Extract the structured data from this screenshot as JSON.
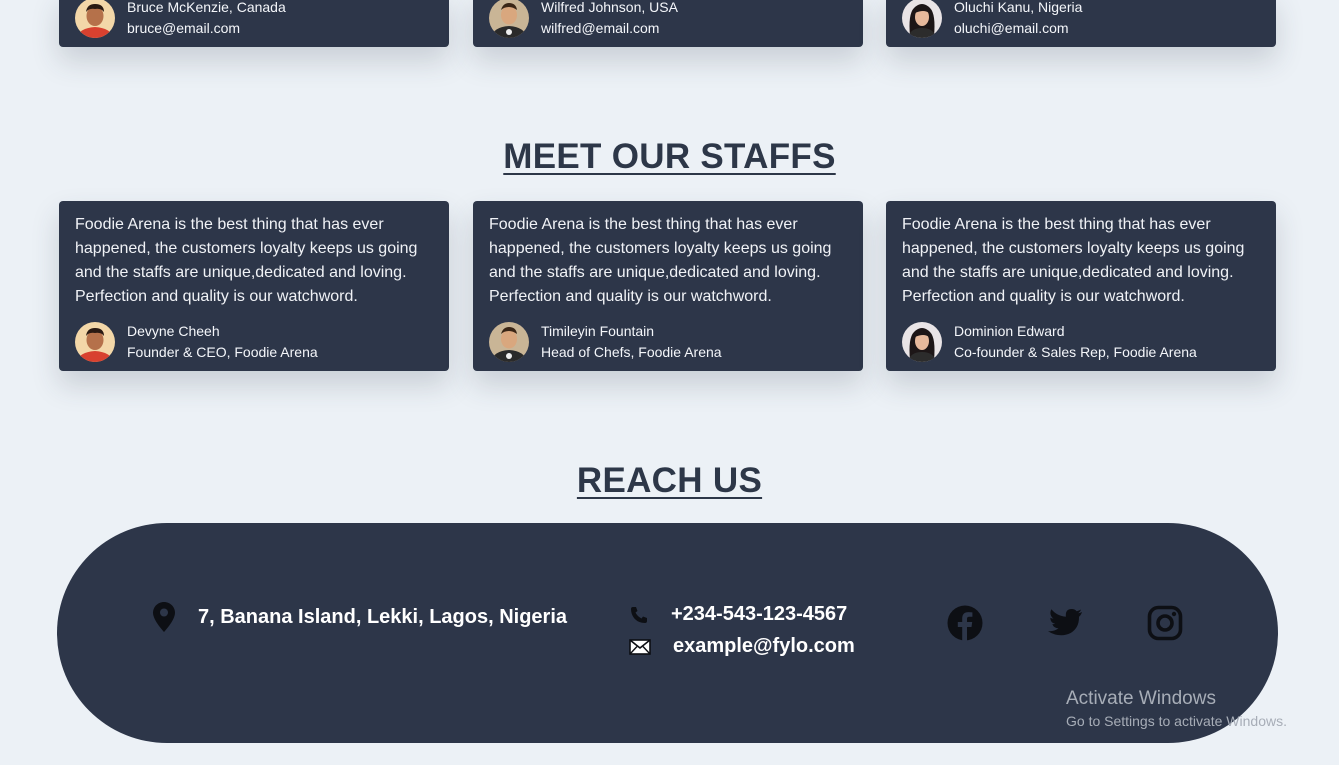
{
  "customers": [
    {
      "name": "Bruce McKenzie, Canada",
      "email": "bruce@email.com",
      "avatar": "avatar-man-red-shirt"
    },
    {
      "name": "Wilfred Johnson, USA",
      "email": "wilfred@email.com",
      "avatar": "avatar-man-dark-shirt"
    },
    {
      "name": "Oluchi Kanu, Nigeria",
      "email": "oluchi@email.com",
      "avatar": "avatar-woman"
    }
  ],
  "staff_section": {
    "title": "MEET OUR STAFFS",
    "cards": [
      {
        "quote": "Foodie Arena is the best thing that has ever happened, the customers loyalty keeps us going and the staffs are unique,dedicated and loving. Perfection and quality is our watchword.",
        "name": "Devyne Cheeh",
        "role": "Founder & CEO, Foodie Arena"
      },
      {
        "quote": "Foodie Arena is the best thing that has ever happened, the customers loyalty keeps us going and the staffs are unique,dedicated and loving. Perfection and quality is our watchword.",
        "name": "Timileyin Fountain",
        "role": "Head of Chefs, Foodie Arena"
      },
      {
        "quote": "Foodie Arena is the best thing that has ever happened, the customers loyalty keeps us going and the staffs are unique,dedicated and loving. Perfection and quality is our watchword.",
        "name": "Dominion Edward",
        "role": "Co-founder & Sales Rep, Foodie Arena"
      }
    ]
  },
  "reach_section": {
    "title": "REACH US",
    "address": "7, Banana Island, Lekki, Lagos, Nigeria",
    "phone": "+234-543-123-4567",
    "email": "example@fylo.com",
    "socials": [
      "facebook-icon",
      "twitter-icon",
      "instagram-icon"
    ]
  },
  "watermark": {
    "line1": "Activate Windows",
    "line2": "Go to Settings to activate Windows."
  },
  "colors": {
    "background": "#ecf1f6",
    "card": "#2d3649",
    "heading": "#2d3748"
  }
}
